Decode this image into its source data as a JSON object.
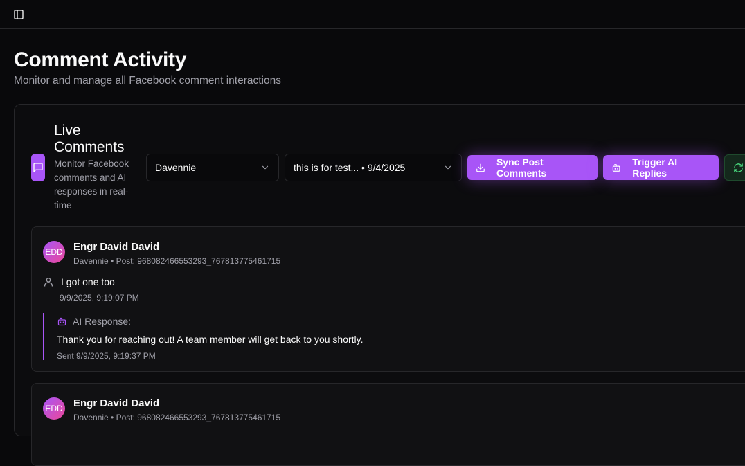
{
  "header": {
    "sidebar_toggle_icon": "panel-left-icon"
  },
  "page": {
    "title": "Comment Activity",
    "subtitle": "Monitor and manage all Facebook comment interactions"
  },
  "live": {
    "title": "Live Comments",
    "description": "Monitor Facebook comments and AI responses in real-time",
    "icon": "message-square-icon",
    "page_select": {
      "value": "Davennie"
    },
    "post_select": {
      "value": "this is for test... • 9/4/2025"
    },
    "sync_label": "Sync Post Comments",
    "trigger_label": "Trigger AI Replies",
    "accent": "#a855f7"
  },
  "comments": [
    {
      "initials": "EDD",
      "author": "Engr David David",
      "meta": "Davennie • Post: 968082466553293_767813775461715",
      "text": "I got one too",
      "time": "9/9/2025, 9:19:07 PM",
      "ai_label": "AI Response:",
      "ai_text": "Thank you for reaching out! A team member will get back to you shortly.",
      "ai_sent": "Sent 9/9/2025, 9:19:37 PM"
    },
    {
      "initials": "EDD",
      "author": "Engr David David",
      "meta": "Davennie • Post: 968082466553293_767813775461715"
    }
  ]
}
